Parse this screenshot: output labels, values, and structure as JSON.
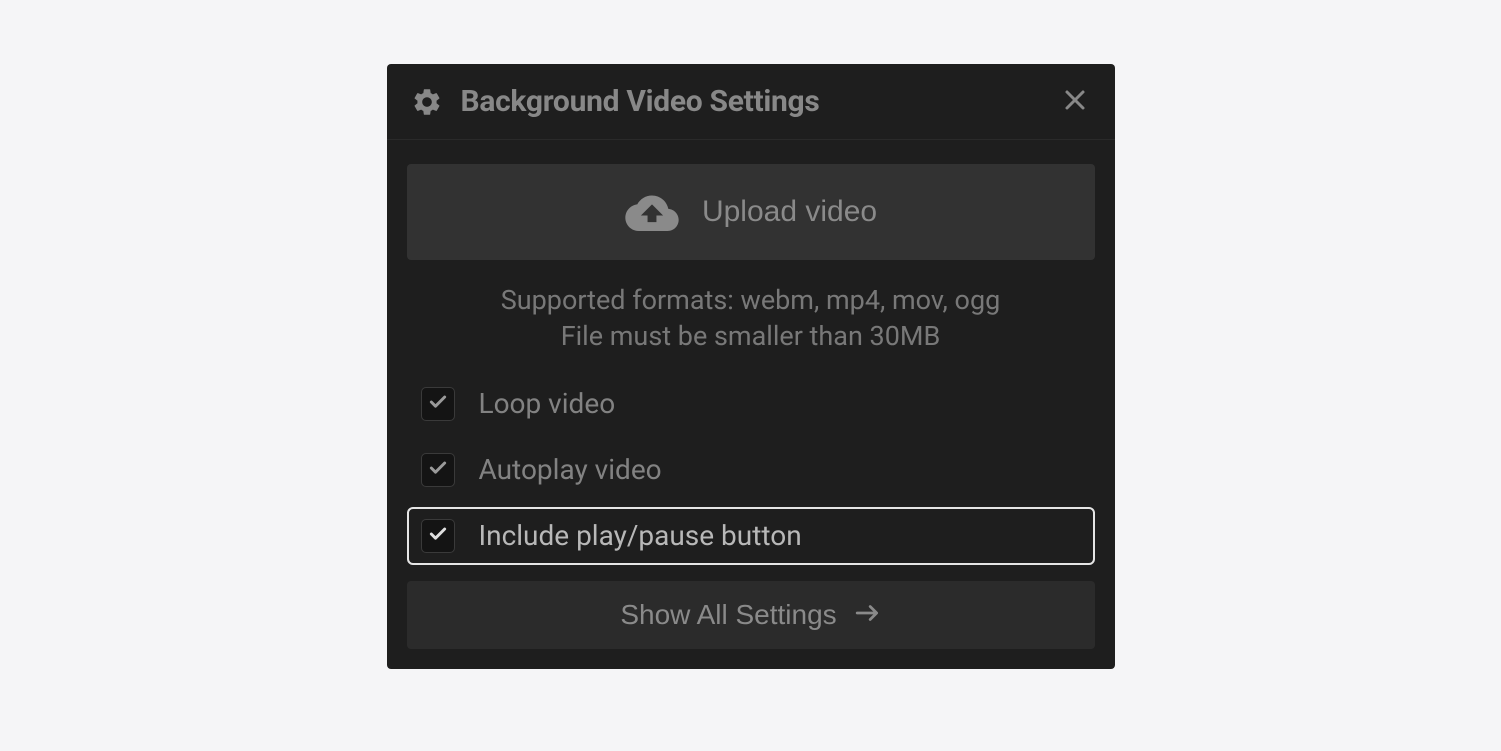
{
  "panel": {
    "title": "Background Video Settings",
    "upload_label": "Upload video",
    "help_line1": "Supported formats: webm, mp4, mov, ogg",
    "help_line2": "File must be smaller than 30MB",
    "options": [
      {
        "label": "Loop video",
        "checked": true,
        "highlighted": false
      },
      {
        "label": "Autoplay video",
        "checked": true,
        "highlighted": false
      },
      {
        "label": "Include play/pause button",
        "checked": true,
        "highlighted": true
      }
    ],
    "show_all_label": "Show All Settings"
  }
}
